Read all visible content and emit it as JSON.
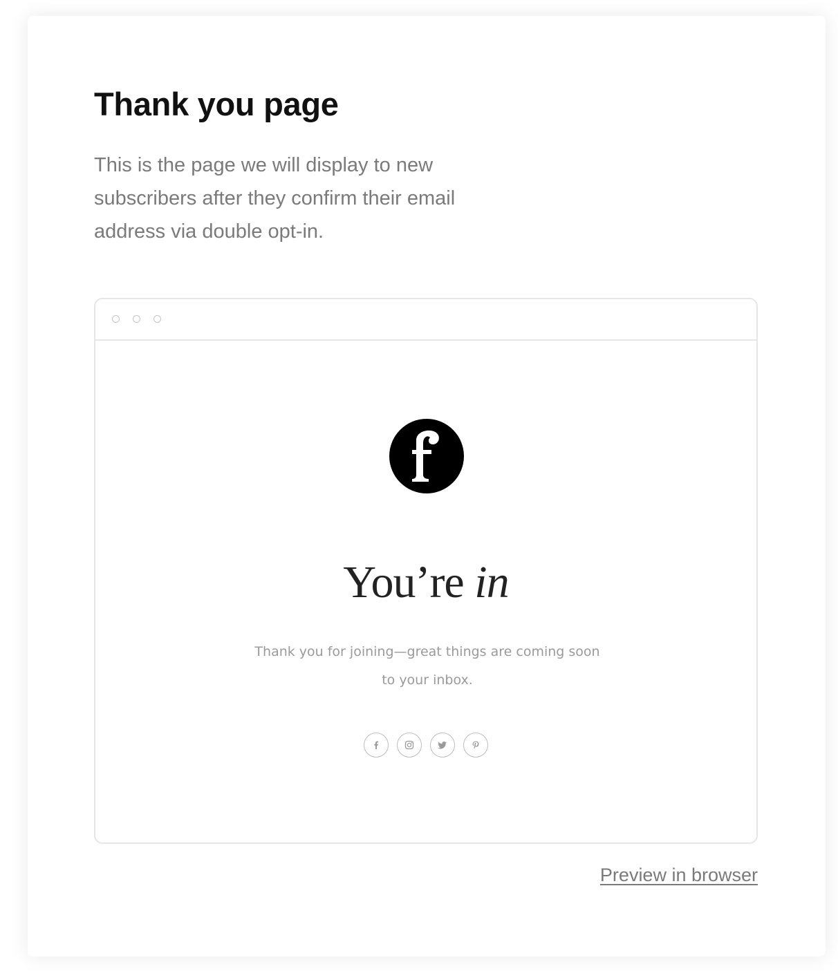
{
  "page": {
    "title": "Thank you page",
    "description": "This is the page we will display to new subscribers after they confirm their email address via double opt-in."
  },
  "preview": {
    "headline_main": "You’re ",
    "headline_emphasis": "in",
    "message": "Thank you for joining—great things are coming soon to your inbox.",
    "socials": [
      {
        "name": "facebook",
        "icon": "facebook-icon"
      },
      {
        "name": "instagram",
        "icon": "instagram-icon"
      },
      {
        "name": "twitter",
        "icon": "twitter-icon"
      },
      {
        "name": "pinterest",
        "icon": "pinterest-icon"
      }
    ]
  },
  "actions": {
    "preview_link_label": "Preview in browser"
  },
  "colors": {
    "title": "#111111",
    "muted_text": "#7a7a7a",
    "border": "#e6e6e6",
    "logo": "#000000"
  }
}
